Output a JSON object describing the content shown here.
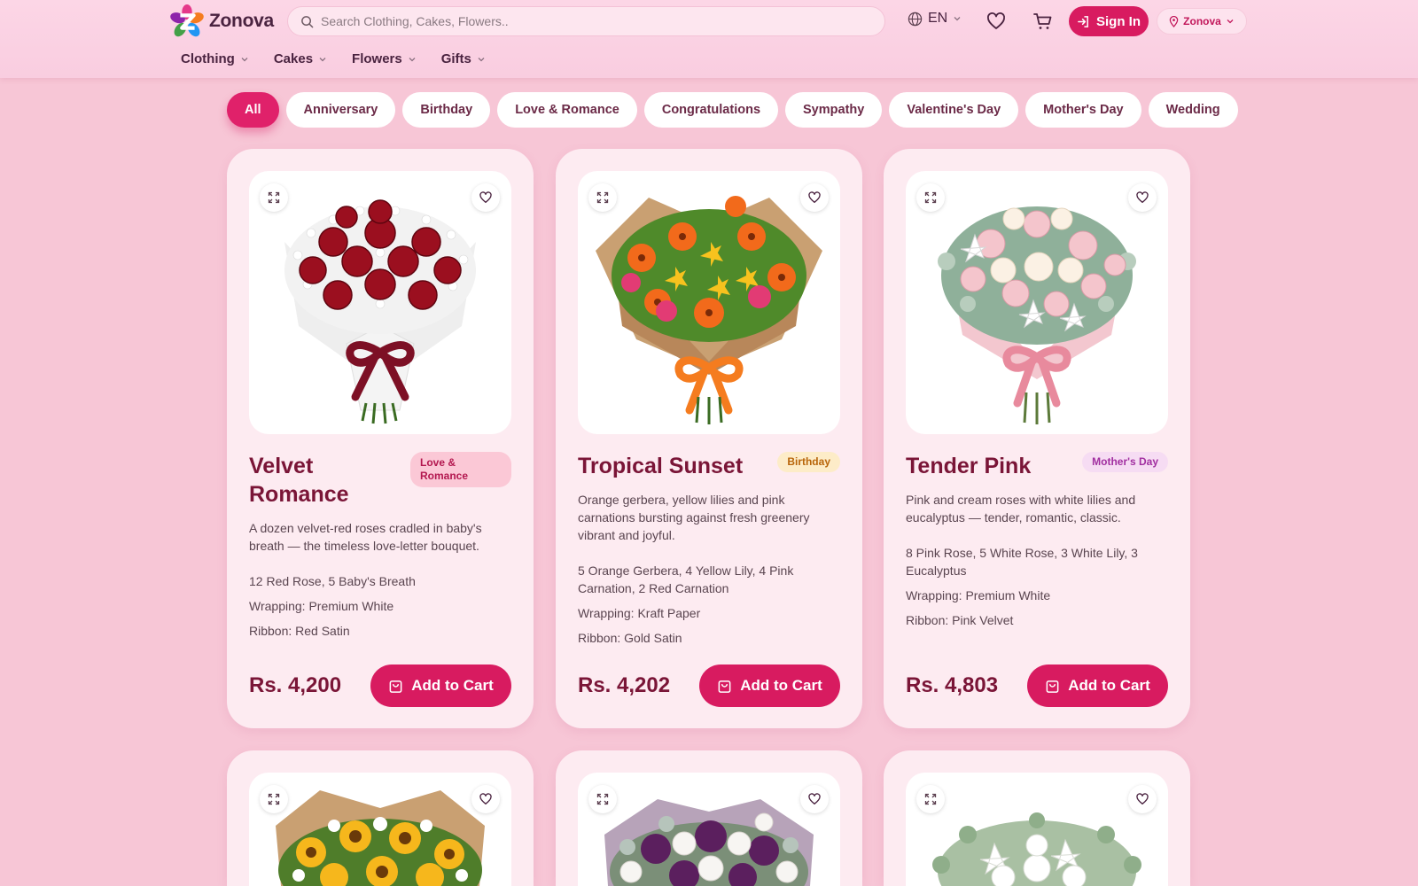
{
  "brand": {
    "name": "Zonova"
  },
  "search": {
    "placeholder": "Search Clothing, Cakes, Flowers.."
  },
  "header": {
    "language": "EN",
    "signin_label": "Sign In",
    "store_label": "Zonova"
  },
  "nav": [
    {
      "label": "Clothing"
    },
    {
      "label": "Cakes"
    },
    {
      "label": "Flowers"
    },
    {
      "label": "Gifts"
    }
  ],
  "filters": [
    {
      "label": "All",
      "active": true
    },
    {
      "label": "Anniversary"
    },
    {
      "label": "Birthday"
    },
    {
      "label": "Love & Romance"
    },
    {
      "label": "Congratulations"
    },
    {
      "label": "Sympathy"
    },
    {
      "label": "Valentine's Day"
    },
    {
      "label": "Mother's Day"
    },
    {
      "label": "Wedding"
    }
  ],
  "products": [
    {
      "title": "Velvet Romance",
      "badge": "Love & Romance",
      "description": "A dozen velvet-red roses cradled in baby's breath — the timeless love-letter bouquet.",
      "contents": "12 Red Rose, 5 Baby's Breath",
      "wrapping": "Wrapping: Premium White",
      "ribbon": "Ribbon: Red Satin",
      "price": "Rs. 4,200",
      "cart_label": "Add to Cart"
    },
    {
      "title": "Tropical Sunset",
      "badge": "Birthday",
      "description": "Orange gerbera, yellow lilies and pink carnations bursting against fresh greenery vibrant and joyful.",
      "contents": "5 Orange Gerbera, 4 Yellow Lily, 4 Pink Carnation, 2 Red Carnation",
      "wrapping": "Wrapping: Kraft Paper",
      "ribbon": "Ribbon: Gold Satin",
      "price": "Rs. 4,202",
      "cart_label": "Add to Cart"
    },
    {
      "title": "Tender Pink",
      "badge": "Mother's Day",
      "description": "Pink and cream roses with white lilies and eucalyptus — tender, romantic, classic.",
      "contents": "8 Pink Rose, 5 White Rose, 3 White Lily, 3 Eucalyptus",
      "wrapping": "Wrapping: Premium White",
      "ribbon": "Ribbon: Pink Velvet",
      "price": "Rs. 4,803",
      "cart_label": "Add to Cart"
    }
  ],
  "colors": {
    "accent": "#d81b60",
    "background": "#f7c6d6",
    "badge_love_bg": "#fbc8d6",
    "badge_birthday_bg": "#fdecc8",
    "badge_mothers_bg": "#f6dcf3"
  }
}
